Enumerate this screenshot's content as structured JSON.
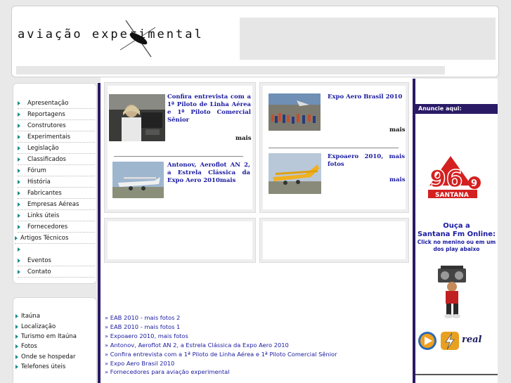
{
  "header": {
    "logo_text": "aviação experimental"
  },
  "menu_main": [
    {
      "label": "Apresentação"
    },
    {
      "label": "Reportagens"
    },
    {
      "label": "Construtores"
    },
    {
      "label": "Experimentais"
    },
    {
      "label": "Legislação"
    },
    {
      "label": "Classificados"
    },
    {
      "label": "Fórum"
    },
    {
      "label": "História"
    },
    {
      "label": "Fabricantes"
    },
    {
      "label": "Empresas Aéreas"
    },
    {
      "label": "Links úteis"
    },
    {
      "label": "Fornecedores"
    },
    {
      "label": "Artigos Técnicos"
    },
    {
      "label": ""
    },
    {
      "label": "Eventos"
    },
    {
      "label": "Contato"
    }
  ],
  "menu_city": [
    {
      "label": "Itaúna"
    },
    {
      "label": "Localização"
    },
    {
      "label": "Turismo em Itaúna"
    },
    {
      "label": "Fotos"
    },
    {
      "label": "Onde se hospedar"
    },
    {
      "label": "Telefones úteis"
    }
  ],
  "articles": {
    "a1": {
      "title": "Confira entrevista com a 1ª Piloto de Linha Aérea e 1ª Piloto Comercial Sênior",
      "more": "mais"
    },
    "a2": {
      "title": "Antonov, Aeroflot AN 2, a Estrela Clássica da Expo Aero 2010mais"
    },
    "a3": {
      "title": "Expo Aero Brasil 2010",
      "more": "mais"
    },
    "a4": {
      "title": "Expoaero 2010, mais fotos",
      "more": "mais"
    }
  },
  "news_list": [
    {
      "text": "» EAB 2010 - mais fotos 2"
    },
    {
      "text": "» EAB 2010 - mais fotos 1"
    },
    {
      "text": "» Expoaero 2010, mais fotos"
    },
    {
      "text": "» Antonov, Aeroflot AN 2, a Estrela Clássica da Expo Aero 2010"
    },
    {
      "text": "» Confira entrevista com a 1ª Piloto de Linha Aérea e 1ª Piloto Comercial Sênior"
    },
    {
      "text": "» Expo Aero Brasil 2010"
    },
    {
      "text": "» Fornecedores para aviação experimental"
    }
  ],
  "sidebar_right": {
    "anuncie": "Anuncie aqui:",
    "radio_logo_number": "96",
    "radio_logo_decimal": "9",
    "radio_logo_name": "SANTANA",
    "listen_line1": "Ouça a",
    "listen_line2": "Santana Fm Online:",
    "listen_hint": "Click no menino ou em um dos play abaixo",
    "player_real": "real"
  },
  "colors": {
    "link": "#1a1aa0",
    "accent_bar": "#2a1a66",
    "arrow": "#1a8a8a",
    "radio_red": "#d42020"
  }
}
